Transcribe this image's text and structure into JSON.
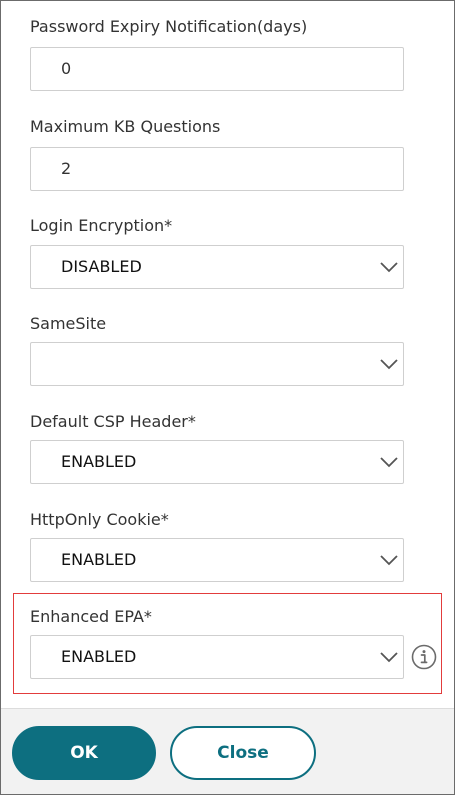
{
  "form": {
    "password_expiry": {
      "label": "Password Expiry Notification(days)",
      "value": "0"
    },
    "max_kb_questions": {
      "label": "Maximum KB Questions",
      "value": "2"
    },
    "login_encryption": {
      "label": "Login Encryption*",
      "value": "DISABLED"
    },
    "samesite": {
      "label": "SameSite",
      "value": ""
    },
    "default_csp_header": {
      "label": "Default CSP Header*",
      "value": "ENABLED"
    },
    "httponly_cookie": {
      "label": "HttpOnly Cookie*",
      "value": "ENABLED"
    },
    "enhanced_epa": {
      "label": "Enhanced EPA*",
      "value": "ENABLED"
    }
  },
  "footer": {
    "ok_label": "OK",
    "close_label": "Close"
  },
  "colors": {
    "primary": "#0d6f80",
    "highlight_border": "#e23c3c",
    "field_border": "#cfcfcf"
  },
  "icons": {
    "dropdown": "chevron-down-icon",
    "info": "info-icon"
  }
}
